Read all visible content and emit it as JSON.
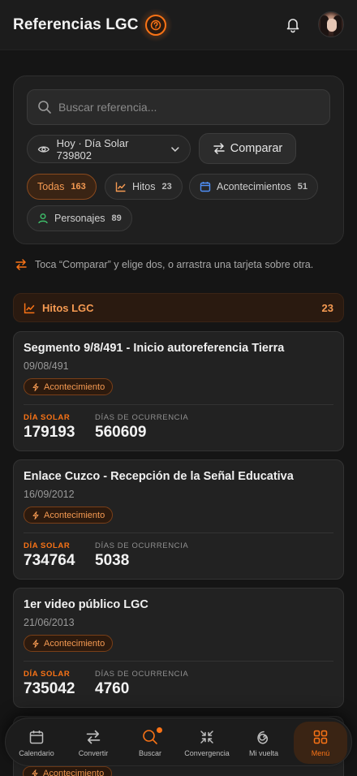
{
  "header": {
    "title": "Referencias LGC",
    "help_icon": "question-circle-icon",
    "bell_icon": "bell-icon",
    "avatar": "user-avatar"
  },
  "filters": {
    "search_placeholder": "Buscar referencia...",
    "day_select_label": "Hoy · Día Solar 739802",
    "compare_label": "Comparar",
    "chips": [
      {
        "label": "Todas",
        "count": "163",
        "active": true
      },
      {
        "label": "Hitos",
        "count": "23",
        "icon": "trend-chart-icon"
      },
      {
        "label": "Acontecimientos",
        "count": "51",
        "icon": "calendar-icon"
      },
      {
        "label": "Personajes",
        "count": "89",
        "icon": "person-icon"
      }
    ]
  },
  "hint": "Toca “Comparar” y elige dos, o arrastra una tarjeta sobre otra.",
  "section": {
    "label": "Hitos LGC",
    "count": "23"
  },
  "cards": [
    {
      "title": "Segmento 9/8/491 - Inicio autoreferencia Tierra",
      "date": "09/08/491",
      "tag": "Acontecimiento",
      "stat1_label": "DÍA SOLAR",
      "stat1_value": "179193",
      "stat2_label": "DÍAS DE OCURRENCIA",
      "stat2_value": "560609"
    },
    {
      "title": "Enlace Cuzco - Recepción de la Señal Educativa",
      "date": "16/09/2012",
      "tag": "Acontecimiento",
      "stat1_label": "DÍA SOLAR",
      "stat1_value": "734764",
      "stat2_label": "DÍAS DE OCURRENCIA",
      "stat2_value": "5038"
    },
    {
      "title": "1er video público LGC",
      "date": "21/06/2013",
      "tag": "Acontecimiento",
      "stat1_label": "DÍA SOLAR",
      "stat1_value": "735042",
      "stat2_label": "DÍAS DE OCURRENCIA",
      "stat2_value": "4760"
    }
  ],
  "peek_tag": "Acontecimiento",
  "nav": {
    "items": [
      {
        "label": "Calendario",
        "icon": "calendar-icon"
      },
      {
        "label": "Convertir",
        "icon": "swap-icon"
      },
      {
        "label": "Buscar",
        "icon": "search-icon",
        "badge": true
      },
      {
        "label": "Convergencia",
        "icon": "converge-icon"
      },
      {
        "label": "Mi vuelta",
        "icon": "spiral-icon"
      },
      {
        "label": "Menú",
        "icon": "grid-icon",
        "active": true
      }
    ]
  },
  "colors": {
    "accent": "#f97316",
    "background": "#151515",
    "card": "#222222"
  }
}
